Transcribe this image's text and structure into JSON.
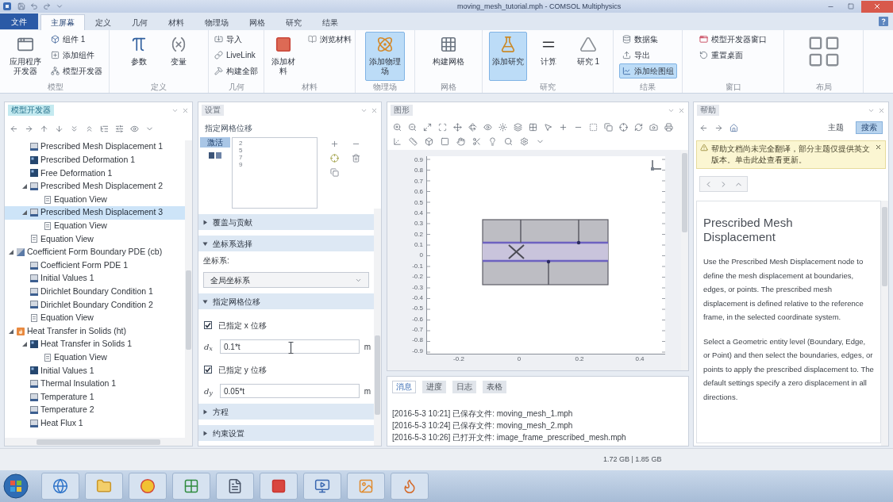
{
  "window": {
    "title": "moving_mesh_tutorial.mph - COMSOL Multiphysics"
  },
  "ribbon": {
    "file_button": "文件",
    "tabs": [
      {
        "label": "主屏幕",
        "selected": true
      },
      {
        "label": "定义",
        "selected": false
      },
      {
        "label": "几何",
        "selected": false
      },
      {
        "label": "材料",
        "selected": false
      },
      {
        "label": "物理场",
        "selected": false
      },
      {
        "label": "网格",
        "selected": false
      },
      {
        "label": "研究",
        "selected": false
      },
      {
        "label": "结果",
        "selected": false
      }
    ],
    "groups": [
      {
        "label": "模型",
        "buttons": [
          {
            "kind": "large",
            "label": "应用程序开发器",
            "on": false
          },
          {
            "kind": "small",
            "label": "组件 1",
            "on": false
          },
          {
            "kind": "small",
            "label": "添加组件",
            "on": false
          },
          {
            "kind": "small",
            "label": "模型开发器",
            "on": false
          }
        ]
      },
      {
        "label": "定义",
        "buttons": [
          {
            "kind": "large",
            "label": "参数",
            "on": false
          },
          {
            "kind": "large",
            "label": "变量",
            "on": false
          }
        ]
      },
      {
        "label": "几何",
        "buttons": [
          {
            "kind": "small",
            "label": "导入",
            "on": false
          },
          {
            "kind": "small",
            "label": "LiveLink",
            "on": false
          },
          {
            "kind": "small",
            "label": "构建全部",
            "on": false
          }
        ]
      },
      {
        "label": "材料",
        "buttons": [
          {
            "kind": "large",
            "label": "添加材料",
            "on": false
          },
          {
            "kind": "small",
            "label": "浏览材料",
            "on": false
          }
        ]
      },
      {
        "label": "物理场",
        "buttons": [
          {
            "kind": "large",
            "label": "添加物理场",
            "on": true
          }
        ]
      },
      {
        "label": "网格",
        "buttons": [
          {
            "kind": "large",
            "label": "构建网格",
            "on": false
          }
        ]
      },
      {
        "label": "研究",
        "buttons": [
          {
            "kind": "large",
            "label": "添加研究",
            "on": true
          },
          {
            "kind": "large",
            "label": "计算",
            "on": false
          },
          {
            "kind": "large",
            "label": "研究 1",
            "on": false
          }
        ]
      },
      {
        "label": "结果",
        "buttons": [
          {
            "kind": "small",
            "label": "数据集",
            "on": false
          },
          {
            "kind": "small",
            "label": "导出",
            "on": false
          },
          {
            "kind": "small",
            "label": "添加绘图组",
            "on": true
          }
        ]
      },
      {
        "label": "窗口",
        "buttons": [
          {
            "kind": "small",
            "label": "模型开发器窗口",
            "on": false
          },
          {
            "kind": "small",
            "label": "重置桌面",
            "on": false
          }
        ]
      },
      {
        "label": "布局",
        "buttons": [
          {
            "kind": "icon",
            "on": false
          }
        ]
      }
    ]
  },
  "model_builder": {
    "title": "模型开发器",
    "tree": {
      "branch_continued": [
        {
          "label": "Prescribed Mesh Displacement 1",
          "kind": "boundary",
          "selected": false
        },
        {
          "label": "Prescribed Deformation 1",
          "kind": "domain",
          "selected": false
        },
        {
          "label": "Free Deformation 1",
          "kind": "domain",
          "selected": false
        },
        {
          "label": "Prescribed Mesh Displacement 2",
          "kind": "boundary",
          "selected": false,
          "expanded": true,
          "children": [
            {
              "label": "Equation View",
              "kind": "equation",
              "selected": false
            }
          ]
        },
        {
          "label": "Prescribed Mesh Displacement 3",
          "kind": "boundary",
          "selected": true,
          "expanded": true,
          "children": [
            {
              "label": "Equation View",
              "kind": "equation",
              "selected": false
            }
          ]
        },
        {
          "label": "Equation View",
          "kind": "equation",
          "selected": false
        }
      ],
      "items": [
        {
          "label": "Coefficient Form Boundary PDE (cb)",
          "kind": "interface",
          "selected": false,
          "expanded": true,
          "children": [
            {
              "label": "Coefficient Form PDE 1",
              "kind": "boundary",
              "selected": false
            },
            {
              "label": "Initial Values 1",
              "kind": "boundary",
              "selected": false
            },
            {
              "label": "Dirichlet Boundary Condition 1",
              "kind": "boundary",
              "selected": false
            },
            {
              "label": "Dirichlet Boundary Condition 2",
              "kind": "boundary",
              "selected": false
            },
            {
              "label": "Equation View",
              "kind": "equation",
              "selected": false
            }
          ]
        },
        {
          "label": "Heat Transfer in Solids (ht)",
          "kind": "heat",
          "selected": false,
          "expanded": true,
          "children": [
            {
              "label": "Heat Transfer in Solids 1",
              "kind": "domain",
              "selected": false,
              "expanded": true,
              "children": [
                {
                  "label": "Equation View",
                  "kind": "equation",
                  "selected": false
                }
              ]
            },
            {
              "label": "Initial Values 1",
              "kind": "domain",
              "selected": false
            },
            {
              "label": "Thermal Insulation 1",
              "kind": "boundary",
              "selected": false
            },
            {
              "label": "Temperature 1",
              "kind": "boundary",
              "selected": false
            },
            {
              "label": "Temperature 2",
              "kind": "boundary",
              "selected": false
            },
            {
              "label": "Heat Flux 1",
              "kind": "boundary",
              "selected": false
            }
          ]
        }
      ]
    }
  },
  "settings": {
    "title": "设置",
    "feature": "指定网格位移",
    "selection": {
      "toggle": {
        "label": "激活",
        "on": true
      },
      "items": [
        "2",
        "5",
        "7",
        "9"
      ]
    },
    "sections": [
      {
        "title": "覆盖与贡献",
        "expanded": false
      },
      {
        "title": "坐标系选择",
        "expanded": true,
        "rows": [
          {
            "kind": "label",
            "text": "坐标系:"
          },
          {
            "kind": "dropdown",
            "value": "全局坐标系"
          }
        ]
      },
      {
        "title": "指定网格位移",
        "expanded": true,
        "rows": [
          {
            "kind": "checkbox",
            "text": "已指定 x 位移",
            "checked": true
          },
          {
            "kind": "input",
            "symbol": "d$_{x}$",
            "value": "0.1*t",
            "unit": "m"
          },
          {
            "kind": "checkbox",
            "text": "已指定 y 位移",
            "checked": true
          },
          {
            "kind": "input",
            "symbol": "d$_{y}$",
            "value": "0.05*t",
            "unit": "m"
          }
        ]
      },
      {
        "title": "方程",
        "expanded": false
      },
      {
        "title": "约束设置",
        "expanded": false
      }
    ]
  },
  "graphics": {
    "title": "图形",
    "y_axis_labels": [
      "0.9",
      "0.8",
      "0.7",
      "0.6",
      "0.5",
      "0.4",
      "0.3",
      "0.2",
      "0.1",
      "0",
      "-0.1",
      "-0.2",
      "-0.3",
      "-0.4",
      "-0.5",
      "-0.6",
      "-0.7",
      "-0.8",
      "-0.9"
    ],
    "x_axis_labels": [
      "-0.2",
      "0",
      "0.2",
      "0.4"
    ]
  },
  "messages": {
    "tabs": [
      {
        "label": "消息",
        "selected": true
      },
      {
        "label": "进度",
        "selected": false
      },
      {
        "label": "日志",
        "selected": false
      },
      {
        "label": "表格",
        "selected": false
      }
    ],
    "lines": [
      "[2016-5-3 10:21] 已保存文件: moving_mesh_1.mph",
      "[2016-5-3 10:24] 已保存文件: moving_mesh_2.mph",
      "[2016-5-3 10:26] 已打开文件: image_frame_prescribed_mesh.mph"
    ]
  },
  "help": {
    "title": "帮助",
    "toggles": [
      {
        "label": "主题",
        "selected": false
      },
      {
        "label": "搜索",
        "selected": true
      }
    ],
    "notice": "帮助文档尚未完全翻译，部分主题仅提供英文版本。单击此处查看更新。",
    "heading": "Prescribed Mesh Displacement",
    "paragraphs": [
      "Use the Prescribed Mesh Displacement node to define the mesh displacement at boundaries, edges, or points. The prescribed mesh displacement is defined relative to the reference frame, in the selected coordinate system.",
      "Select a Geometric entity level (Boundary, Edge, or Point) and then select the boundaries, edges, or points to apply the prescribed displacement to. The default settings specify a zero displacement in all directions."
    ]
  },
  "status_bar": {
    "memory": "1.72 GB | 1.85 GB"
  }
}
